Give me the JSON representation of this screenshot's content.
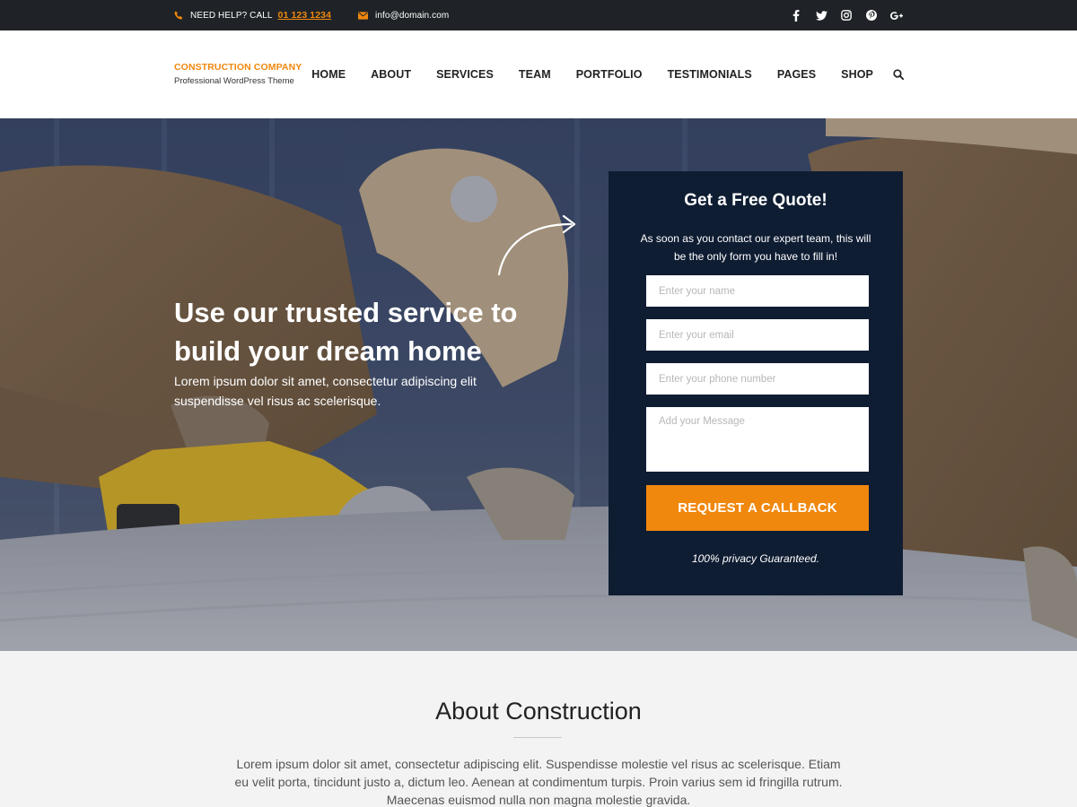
{
  "topbar": {
    "help_label": "NEED HELP? CALL",
    "phone": "01 123 1234",
    "email": "info@domain.com",
    "social_icons": [
      "facebook-icon",
      "twitter-icon",
      "instagram-icon",
      "pinterest-icon",
      "google-plus-icon"
    ]
  },
  "brand": {
    "name": "CONSTRUCTION COMPANY",
    "tagline": "Professional WordPress Theme"
  },
  "nav": {
    "items": [
      "HOME",
      "ABOUT",
      "SERVICES",
      "TEAM",
      "PORTFOLIO",
      "TESTIMONIALS",
      "PAGES",
      "SHOP"
    ]
  },
  "hero": {
    "title": "Use our trusted service to build your dream home",
    "text": "Lorem ipsum dolor sit amet, consectetur adipiscing elit suspendisse vel risus ac scelerisque."
  },
  "quote": {
    "title": "Get a Free Quote!",
    "subtitle": "As soon as you contact our expert team, this will be the only form you have to fill in!",
    "name_placeholder": "Enter your name",
    "email_placeholder": "Enter your email",
    "phone_placeholder": "Enter your phone number",
    "message_placeholder": "Add your Message",
    "button_label": "REQUEST A CALLBACK",
    "privacy": "100% privacy Guaranteed."
  },
  "about": {
    "title": "About Construction",
    "text": "Lorem ipsum dolor sit amet, consectetur adipiscing elit. Suspendisse molestie vel risus ac scelerisque. Etiam eu velit porta, tincidunt justo a, dictum leo. Aenean at condimentum turpis. Proin varius sem id fringilla rutrum. Maecenas euismod nulla non magna molestie gravida."
  },
  "colors": {
    "accent": "#f0880e",
    "topbar_bg": "#1f2327",
    "quote_bg": "#0f1d33"
  }
}
